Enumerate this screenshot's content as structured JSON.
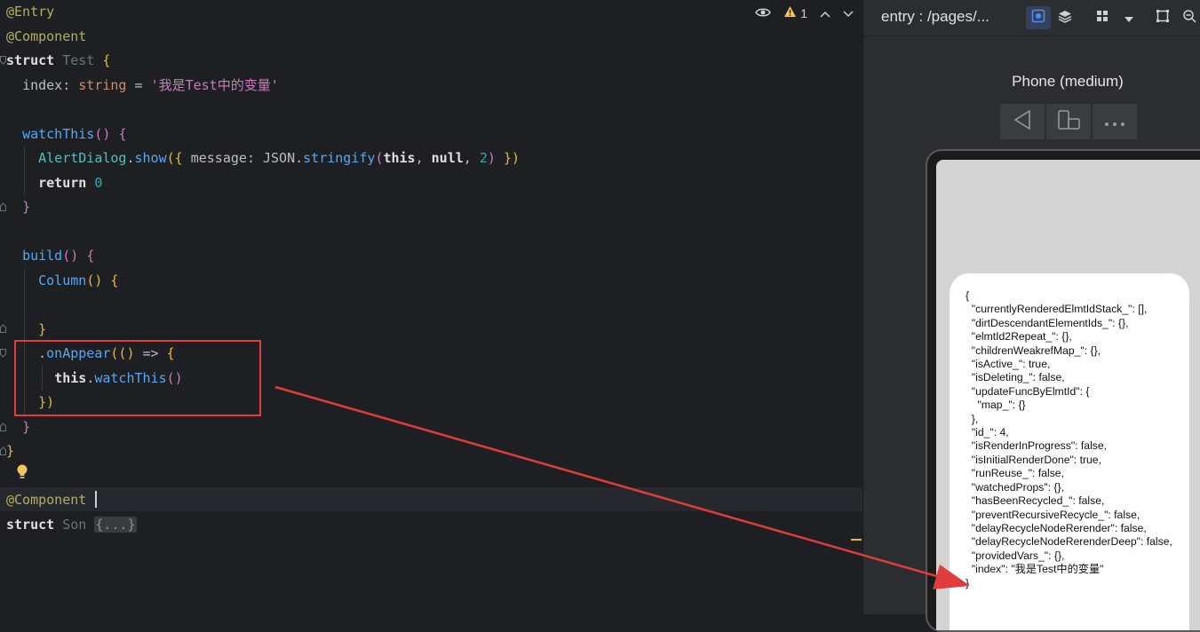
{
  "editor": {
    "lines": {
      "l1": "@Entry",
      "l2": "@Component",
      "l3_kw": "struct",
      "l3_name": "Test",
      "l4_prop": "index",
      "l4_type": "string",
      "l4_val": "'我是Test中的变量'",
      "l6_fn": "watchThis",
      "l7_cls": "AlertDialog",
      "l7_fn": "show",
      "l7_key": "message",
      "l7_json": "JSON",
      "l7_strfy": "stringify",
      "l7_this": "this",
      "l7_null": "null",
      "l7_num": "2",
      "l8_kw": "return",
      "l8_num": "0",
      "l11_fn": "build",
      "l12_fn": "Column",
      "l15_fn": "onAppear",
      "l16_this": "this",
      "l16_fn": "watchThis",
      "l21": "@Component",
      "l22_kw": "struct",
      "l22_name": "Son",
      "l22_collapsed": "{...}"
    },
    "top_bar": {
      "warning_count": "1"
    }
  },
  "preview": {
    "title": "entry : /pages/...",
    "device_name": "Phone (medium)",
    "dialog_message": "{\n  \"currentlyRenderedElmtIdStack_\": [],\n  \"dirtDescendantElementIds_\": {},\n  \"elmtId2Repeat_\": {},\n  \"childrenWeakrefMap_\": {},\n  \"isActive_\": true,\n  \"isDeleting_\": false,\n  \"updateFuncByElmtId\": {\n    \"map_\": {}\n  },\n  \"id_\": 4,\n  \"isRenderInProgress\": false,\n  \"isInitialRenderDone\": true,\n  \"runReuse_\": false,\n  \"watchedProps\": {},\n  \"hasBeenRecycled_\": false,\n  \"preventRecursiveRecycle_\": false,\n  \"delayRecycleNodeRerender\": false,\n  \"delayRecycleNodeRerenderDeep\": false,\n  \"providedVars_\": {},\n  \"index\": \"我是Test中的变量\"\n}"
  },
  "colors": {
    "annotation_red": "#e03c3c",
    "editor_bg": "#1e1f22",
    "preview_bg": "#2b2d30"
  }
}
